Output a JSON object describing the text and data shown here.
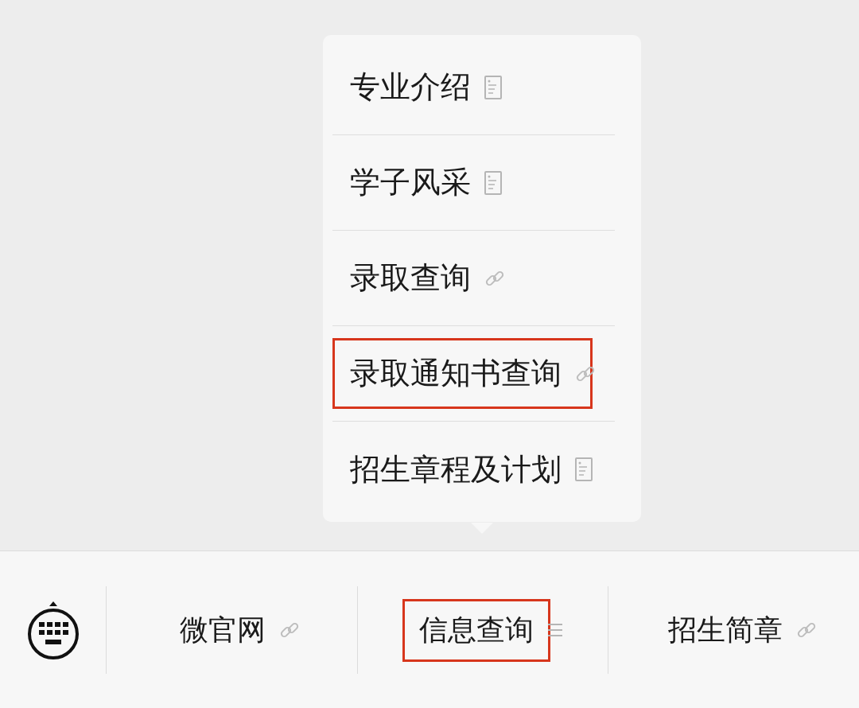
{
  "submenu": {
    "items": [
      {
        "label": "专业介绍",
        "kind": "page",
        "highlighted": false
      },
      {
        "label": "学子风采",
        "kind": "page",
        "highlighted": false
      },
      {
        "label": "录取查询",
        "kind": "link",
        "highlighted": false
      },
      {
        "label": "录取通知书查询",
        "kind": "link",
        "highlighted": true
      },
      {
        "label": "招生章程及计划",
        "kind": "page",
        "highlighted": false
      }
    ]
  },
  "menu_bar": {
    "items": [
      {
        "label": "微官网",
        "kind": "link",
        "highlighted": false
      },
      {
        "label": "信息查询",
        "kind": "list",
        "highlighted": true
      },
      {
        "label": "招生简章",
        "kind": "link",
        "highlighted": false
      }
    ]
  }
}
